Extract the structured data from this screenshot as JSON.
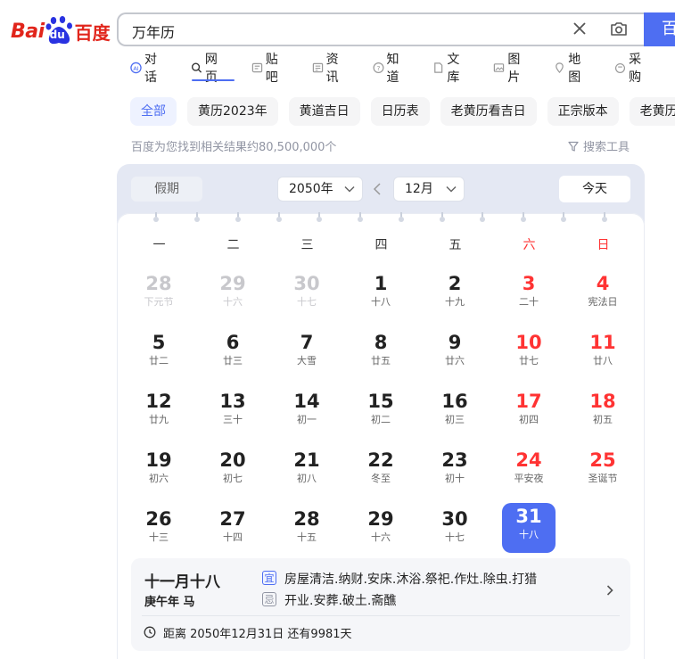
{
  "logo": {
    "part1": "Bai",
    "part2": "du",
    "part3": "百度"
  },
  "search": {
    "value": "万年历",
    "button": "百"
  },
  "tabs": [
    {
      "label": "对话",
      "icon": "ai-chat-icon"
    },
    {
      "label": "网页",
      "icon": "search-icon"
    },
    {
      "label": "贴吧",
      "icon": "tieba-icon"
    },
    {
      "label": "资讯",
      "icon": "news-icon"
    },
    {
      "label": "知道",
      "icon": "question-icon"
    },
    {
      "label": "文库",
      "icon": "doc-icon"
    },
    {
      "label": "图片",
      "icon": "image-icon"
    },
    {
      "label": "地图",
      "icon": "map-icon"
    },
    {
      "label": "采购",
      "icon": "shop-icon"
    }
  ],
  "chips": [
    "全部",
    "黄历2023年",
    "黄道吉日",
    "日历表",
    "老黄历看吉日",
    "正宗版本",
    "老黄历"
  ],
  "result_count": "百度为您找到相关结果约80,500,000个",
  "tools_label": "搜索工具",
  "calendar": {
    "holiday_label": "假期",
    "year": "2050年",
    "month": "12月",
    "today_label": "今天",
    "weekdays": [
      "一",
      "二",
      "三",
      "四",
      "五",
      "六",
      "日"
    ],
    "weeks": [
      [
        {
          "n": "28",
          "l": "下元节",
          "m": true
        },
        {
          "n": "29",
          "l": "十六",
          "m": true
        },
        {
          "n": "30",
          "l": "十七",
          "m": true
        },
        {
          "n": "1",
          "l": "十八"
        },
        {
          "n": "2",
          "l": "十九"
        },
        {
          "n": "3",
          "l": "二十"
        },
        {
          "n": "4",
          "l": "宪法日"
        }
      ],
      [
        {
          "n": "5",
          "l": "廿二"
        },
        {
          "n": "6",
          "l": "廿三"
        },
        {
          "n": "7",
          "l": "大雪"
        },
        {
          "n": "8",
          "l": "廿五"
        },
        {
          "n": "9",
          "l": "廿六"
        },
        {
          "n": "10",
          "l": "廿七"
        },
        {
          "n": "11",
          "l": "廿八"
        }
      ],
      [
        {
          "n": "12",
          "l": "廿九"
        },
        {
          "n": "13",
          "l": "三十"
        },
        {
          "n": "14",
          "l": "初一"
        },
        {
          "n": "15",
          "l": "初二"
        },
        {
          "n": "16",
          "l": "初三"
        },
        {
          "n": "17",
          "l": "初四"
        },
        {
          "n": "18",
          "l": "初五"
        }
      ],
      [
        {
          "n": "19",
          "l": "初六"
        },
        {
          "n": "20",
          "l": "初七"
        },
        {
          "n": "21",
          "l": "初八"
        },
        {
          "n": "22",
          "l": "冬至"
        },
        {
          "n": "23",
          "l": "初十"
        },
        {
          "n": "24",
          "l": "平安夜"
        },
        {
          "n": "25",
          "l": "圣诞节"
        }
      ],
      [
        {
          "n": "26",
          "l": "十三"
        },
        {
          "n": "27",
          "l": "十四"
        },
        {
          "n": "28",
          "l": "十五"
        },
        {
          "n": "29",
          "l": "十六"
        },
        {
          "n": "30",
          "l": "十七"
        },
        {
          "n": "31",
          "l": "十八",
          "sel": true
        }
      ]
    ],
    "info": {
      "lunar_date": "十一月十八",
      "ganzhi": "庚午年 马",
      "yi_label": "宜",
      "yi": "房屋清洁.纳财.安床.沐浴.祭祀.作灶.除虫.打猎",
      "ji_label": "忌",
      "ji": "开业.安葬.破土.斋醮",
      "countdown": "距离 2050年12月31日 还有9981天"
    }
  },
  "colors": {
    "brand": "#4e6ef2",
    "weekend": "#ff3333",
    "logo": "#e1251b"
  }
}
